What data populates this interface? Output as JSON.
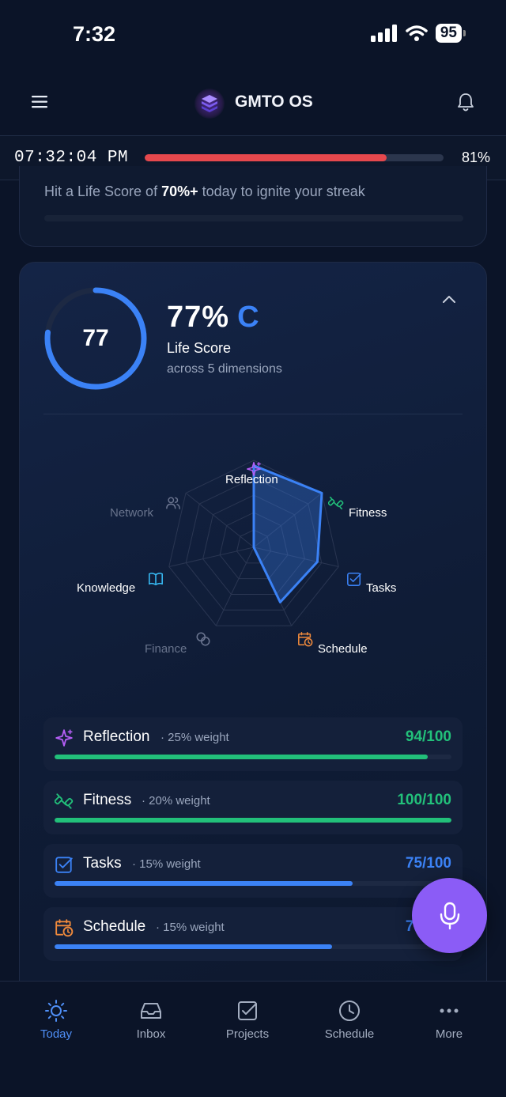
{
  "status_bar": {
    "time": "7:32",
    "battery": "95"
  },
  "header": {
    "title": "GMTO OS"
  },
  "timer": {
    "clock": "07:32:04 PM",
    "day_progress": 0.81,
    "day_progress_label": "81%"
  },
  "streak": {
    "text_before": "Hit a Life Score of ",
    "text_bold": "70%+",
    "text_after": " today to ignite your streak"
  },
  "life_score": {
    "ring_value": "77",
    "percent": "77%",
    "grade": "C",
    "label": "Life Score",
    "subtitle": "across 5 dimensions",
    "fraction": 0.77
  },
  "radar": {
    "axes": [
      {
        "label": "Reflection",
        "icon": "sparkles-icon",
        "value": 94,
        "active": true
      },
      {
        "label": "Fitness",
        "icon": "dumbbell-icon",
        "value": 100,
        "active": true
      },
      {
        "label": "Tasks",
        "icon": "checkbox-icon",
        "value": 75,
        "active": true
      },
      {
        "label": "Schedule",
        "icon": "calendar-clock-icon",
        "value": 70,
        "active": true
      },
      {
        "label": "Finance",
        "icon": "coins-icon",
        "value": 0,
        "active": false
      },
      {
        "label": "Knowledge",
        "icon": "book-icon",
        "value": 0,
        "active": true
      },
      {
        "label": "Network",
        "icon": "users-icon",
        "value": 0,
        "active": false
      }
    ]
  },
  "dimensions": [
    {
      "name": "Reflection",
      "weight": "· 25% weight",
      "score": "94/100",
      "progress": 0.94,
      "color": "#22c07a",
      "icon": "sparkles-icon"
    },
    {
      "name": "Fitness",
      "weight": "· 20% weight",
      "score": "100/100",
      "progress": 1.0,
      "color": "#22c07a",
      "icon": "dumbbell-icon"
    },
    {
      "name": "Tasks",
      "weight": "· 15% weight",
      "score": "75/100",
      "progress": 0.75,
      "color": "#3b82f6",
      "icon": "checkbox-icon"
    },
    {
      "name": "Schedule",
      "weight": "· 15% weight",
      "score": "70/100",
      "progress": 0.7,
      "color": "#3b82f6",
      "icon": "calendar-clock-icon"
    }
  ],
  "tabs": [
    {
      "label": "Today",
      "icon": "sun-icon",
      "active": true
    },
    {
      "label": "Inbox",
      "icon": "inbox-icon",
      "active": false
    },
    {
      "label": "Projects",
      "icon": "checkbox-icon",
      "active": false
    },
    {
      "label": "Schedule",
      "icon": "clock-icon",
      "active": false
    },
    {
      "label": "More",
      "icon": "more-icon",
      "active": false
    }
  ],
  "colors": {
    "accent": "#3b82f6",
    "success": "#22c07a",
    "danger": "#e5484d",
    "mic": "#8b5cf6"
  }
}
